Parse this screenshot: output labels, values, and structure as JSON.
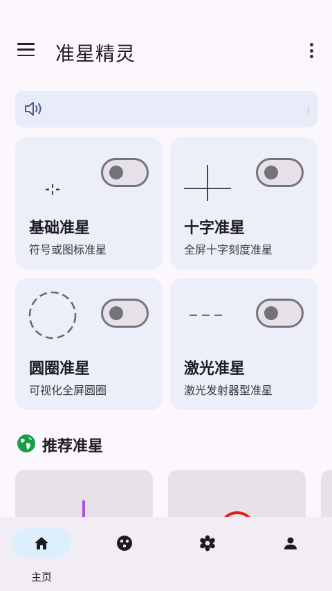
{
  "app": {
    "title": "准星精灵"
  },
  "notice": {
    "text": ""
  },
  "cards": [
    {
      "title": "基础准星",
      "subtitle": "符号或图标准星",
      "icon": "dot-cross-icon",
      "enabled": false
    },
    {
      "title": "十字准星",
      "subtitle": "全屏十字刻度准星",
      "icon": "crosshair-icon",
      "enabled": false
    },
    {
      "title": "圆圈准星",
      "subtitle": "可视化全屏圆圈",
      "icon": "dashed-circle-icon",
      "enabled": false
    },
    {
      "title": "激光准星",
      "subtitle": "激光发射器型准星",
      "icon": "dashed-line-icon",
      "enabled": false
    }
  ],
  "recommended": {
    "title": "推荐准星"
  },
  "nav": {
    "items": [
      {
        "label": "主页",
        "icon": "home-icon",
        "active": true
      },
      {
        "label": "",
        "icon": "palette-icon",
        "active": false
      },
      {
        "label": "",
        "icon": "flower-icon",
        "active": false
      },
      {
        "label": "",
        "icon": "person-icon",
        "active": false
      }
    ]
  },
  "colors": {
    "background": "#fbf7fd",
    "card": "#eceefa",
    "accent": "#1a9e4a",
    "nav_active": "#ddeefc"
  }
}
